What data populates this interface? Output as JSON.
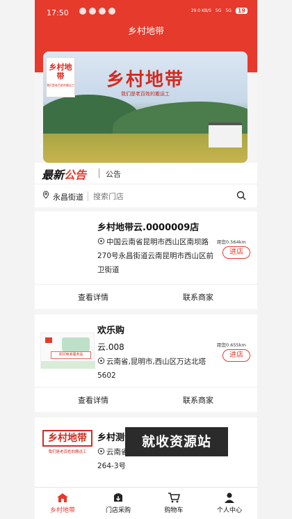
{
  "status_bar": {
    "time": "17:50",
    "net_speed": "29.0 KB/S",
    "signal_a": "5G",
    "signal_b": "5G",
    "battery": "19"
  },
  "header": {
    "title": "乡村地带"
  },
  "banner": {
    "logo_text": "乡村地带",
    "logo_sub": "我们是老百姓的搬运工",
    "title": "乡村地带",
    "subtitle": "我们是老百姓的搬运工"
  },
  "notice": {
    "brand_black": "最新",
    "brand_red": "公告",
    "label": "公告"
  },
  "search": {
    "location": "永昌街道",
    "placeholder": "搜索门店"
  },
  "stores": [
    {
      "name": "乡村地带云.0000009店",
      "address": "中国云南省昆明市西山区南坝路270号永昌街道云南昆明市西山区前卫街道",
      "distance": "距您0.564km",
      "enter": "进店",
      "details": "查看详情",
      "contact": "联系商家"
    },
    {
      "name": "欢乐购",
      "name_line2": "云.008",
      "address": "云南省,昆明市,西山区万达北塔5602",
      "distance": "距您0.655km",
      "enter": "进店",
      "details": "查看详情",
      "contact": "联系商家",
      "thumb_text": "农村电商服务站"
    },
    {
      "name": "乡村测试店",
      "address": "云南省,昆明市,",
      "address2": "264-3号",
      "logo_text": "乡村地带",
      "logo_sub": "我们是老百姓的搬运工"
    }
  ],
  "watermark": "就收资源站",
  "tabs": [
    {
      "label": "乡村地带",
      "icon": "home-icon"
    },
    {
      "label": "门店采购",
      "icon": "store-purchase-icon"
    },
    {
      "label": "购物车",
      "icon": "cart-icon"
    },
    {
      "label": "个人中心",
      "icon": "person-icon"
    }
  ],
  "colors": {
    "accent": "#e53a2c"
  }
}
